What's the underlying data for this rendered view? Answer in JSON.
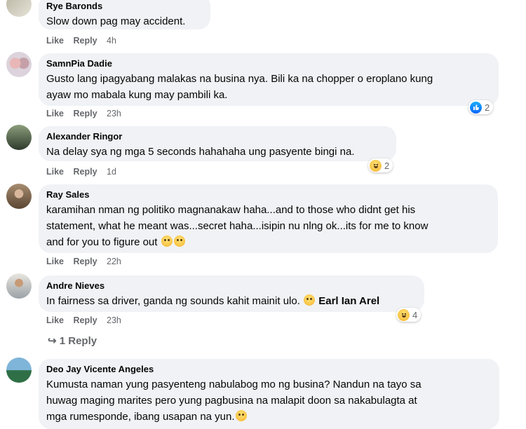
{
  "actions": {
    "like": "Like",
    "reply": "Reply"
  },
  "comments": [
    {
      "author": "Rye Baronds",
      "text": "Slow down pag may accident.",
      "time": "4h"
    },
    {
      "author": "SamnPia Dadie",
      "text_line1": "Gusto lang ipagyabang malakas na busina nya. Bili ka na chopper o eroplano kung",
      "text_line2": "ayaw mo mabala kung may pambili ka.",
      "time": "23h",
      "reaction_count": "2"
    },
    {
      "author": "Alexander Ringor",
      "text": "Na delay sya ng mga 5 seconds hahahaha ung pasyente bingi na.",
      "time": "1d",
      "reaction_count": "2"
    },
    {
      "author": "Ray Sales",
      "text_line1": "karamihan nman ng politiko magnanakaw haha...and to those who didnt get his",
      "text_line2": "statement, what he meant was...secret haha...isipin nu nlng ok...its for me to know",
      "text_line3": "and for you to figure out",
      "time": "22h"
    },
    {
      "author": "Andre Nieves",
      "text": "In fairness sa driver, ganda ng sounds kahit mainit ulo.",
      "mention": "Earl Ian Arel",
      "time": "23h",
      "reaction_count": "4"
    },
    {
      "author": "Deo Jay Vicente Angeles",
      "text_line1": "Kumusta naman yung pasyenteng nabulabog mo ng busina? Nandun na tayo sa",
      "text_line2": "huwag maging marites pero yung pagbusina na malapit doon sa nakabulagta at",
      "text_line3": "mga rumesponde, ibang usapan na yun."
    }
  ],
  "view_replies": "↪ 1 Reply",
  "colors": {
    "bubble": "#f0f2f5",
    "meta": "#65676b",
    "like_blue": "#1877f2"
  }
}
